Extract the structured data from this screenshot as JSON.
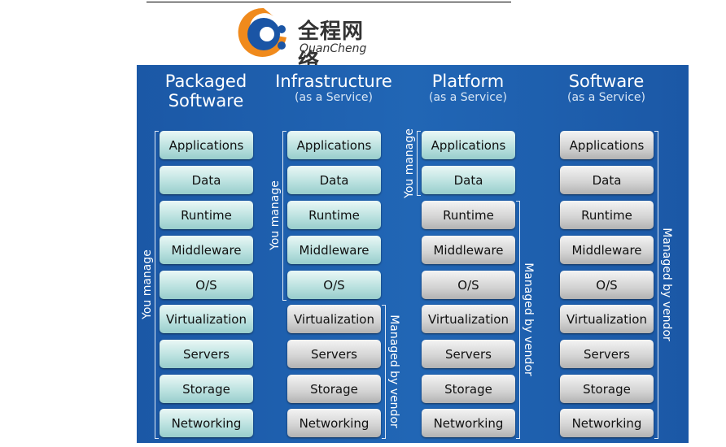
{
  "logo": {
    "cn": "全程网络",
    "en": "QuanCheng",
    "colors": {
      "orange": "#f08a1c",
      "blue": "#1a55a5"
    }
  },
  "columns": [
    {
      "title": "Packaged",
      "title2": "Software",
      "subtitle": ""
    },
    {
      "title": "Infrastructure",
      "title2": "",
      "subtitle": "(as a Service)"
    },
    {
      "title": "Platform",
      "title2": "",
      "subtitle": "(as a Service)"
    },
    {
      "title": "Software",
      "title2": "",
      "subtitle": "(as a Service)"
    }
  ],
  "layers": [
    "Applications",
    "Data",
    "Runtime",
    "Middleware",
    "O/S",
    "Virtualization",
    "Servers",
    "Storage",
    "Networking"
  ],
  "you_manage_counts": [
    9,
    5,
    2,
    0
  ],
  "labels": {
    "you_manage": "You manage",
    "managed_by_vendor": "Managed by vendor"
  },
  "colors": {
    "background": "#1d5eab",
    "you_box": "#b8e0de",
    "vendor_box": "#d2d2d2"
  }
}
